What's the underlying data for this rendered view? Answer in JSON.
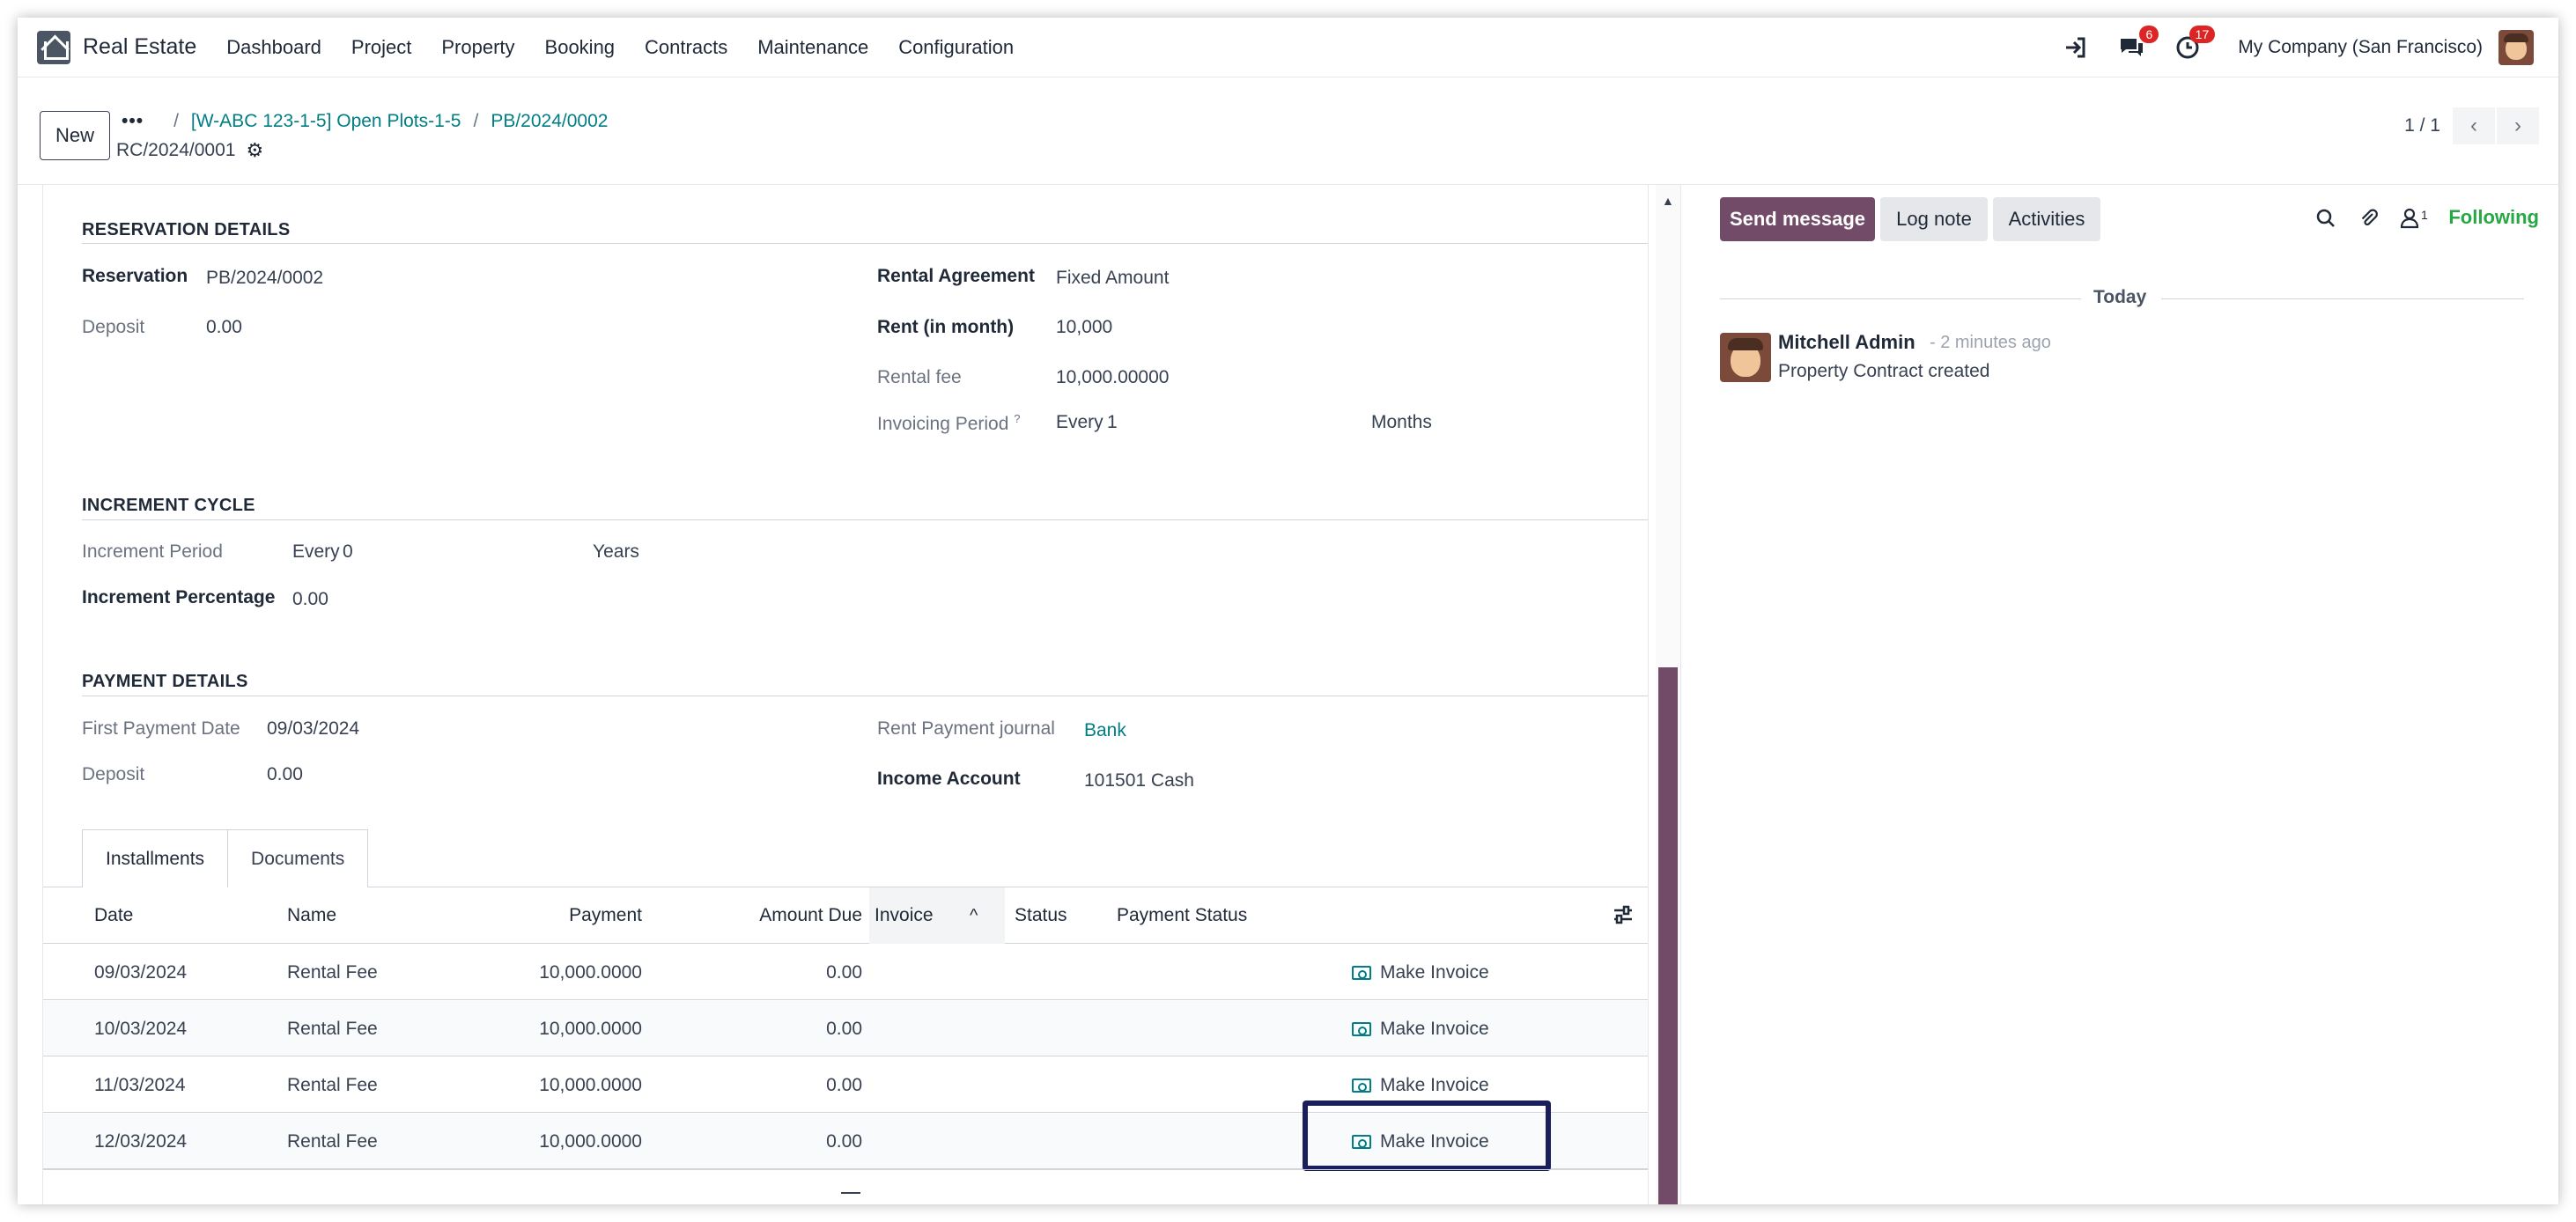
{
  "navbar": {
    "app_name": "Real Estate",
    "menu": [
      "Dashboard",
      "Project",
      "Property",
      "Booking",
      "Contracts",
      "Maintenance",
      "Configuration"
    ],
    "messages_count": "6",
    "activities_count": "17",
    "company": "My Company (San Francisco)"
  },
  "control": {
    "new_label": "New",
    "breadcrumb_dots": "•••",
    "breadcrumb": [
      "[W-ABC 123-1-5] Open Plots-1-5",
      "PB/2024/0002"
    ],
    "record_name": "RC/2024/0001",
    "pager": "1 / 1"
  },
  "reservation": {
    "title": "RESERVATION DETAILS",
    "reservation_label": "Reservation",
    "reservation_value": "PB/2024/0002",
    "deposit_label": "Deposit",
    "deposit_value": "0.00",
    "rental_agreement_label": "Rental Agreement",
    "rental_agreement_value": "Fixed Amount",
    "rent_label": "Rent (in month)",
    "rent_value": "10,000",
    "rental_fee_label": "Rental fee",
    "rental_fee_value": "10,000.00000",
    "invoicing_period_label": "Invoicing Period",
    "invoicing_period_help": "?",
    "invoicing_every": "Every",
    "invoicing_value": "1",
    "invoicing_unit": "Months"
  },
  "increment": {
    "title": "INCREMENT CYCLE",
    "period_label": "Increment Period",
    "period_every": "Every",
    "period_value": "0",
    "period_unit": "Years",
    "percentage_label": "Increment Percentage",
    "percentage_value": "0.00"
  },
  "payment": {
    "title": "PAYMENT DETAILS",
    "first_date_label": "First Payment Date",
    "first_date_value": "09/03/2024",
    "deposit_label": "Deposit",
    "deposit_value": "0.00",
    "journal_label": "Rent Payment journal",
    "journal_value": "Bank",
    "income_label": "Income Account",
    "income_value": "101501 Cash"
  },
  "tabs": [
    "Installments",
    "Documents"
  ],
  "installments": {
    "columns": [
      "Date",
      "Name",
      "Payment",
      "Amount Due",
      "Invoice",
      "Status",
      "Payment Status"
    ],
    "rows": [
      {
        "date": "09/03/2024",
        "name": "Rental Fee",
        "payment": "10,000.0000",
        "amount_due": "0.00",
        "action": "Make Invoice"
      },
      {
        "date": "10/03/2024",
        "name": "Rental Fee",
        "payment": "10,000.0000",
        "amount_due": "0.00",
        "action": "Make Invoice"
      },
      {
        "date": "11/03/2024",
        "name": "Rental Fee",
        "payment": "10,000.0000",
        "amount_due": "0.00",
        "action": "Make Invoice"
      },
      {
        "date": "12/03/2024",
        "name": "Rental Fee",
        "payment": "10,000.0000",
        "amount_due": "0.00",
        "action": "Make Invoice"
      }
    ]
  },
  "chatter": {
    "send_message": "Send message",
    "log_note": "Log note",
    "activities": "Activities",
    "followers_count": "1",
    "following": "Following",
    "today": "Today",
    "message": {
      "author": "Mitchell Admin",
      "time": "- 2 minutes ago",
      "body": "Property Contract created"
    }
  },
  "colors": {
    "brand": "#714b67",
    "link": "#017e84",
    "following": "#28a745",
    "badge": "#dc2626",
    "highlight": "#1a1e5a"
  }
}
